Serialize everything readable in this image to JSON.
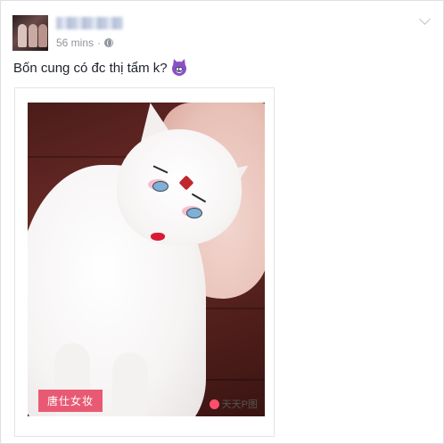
{
  "post": {
    "author_name": "",
    "timestamp": "56 mins",
    "separator": "·",
    "text": "Bốn cung có đc thị tẩm k?",
    "emoji_icon": "smiling-devil-icon",
    "privacy_icon": "globe-icon"
  },
  "photo": {
    "tag_label": "唐仕女妆",
    "watermark_label": "天天P图"
  },
  "colors": {
    "tag_background": "#e85a73",
    "meta_text": "#90949c",
    "body_text": "#1d2129"
  }
}
